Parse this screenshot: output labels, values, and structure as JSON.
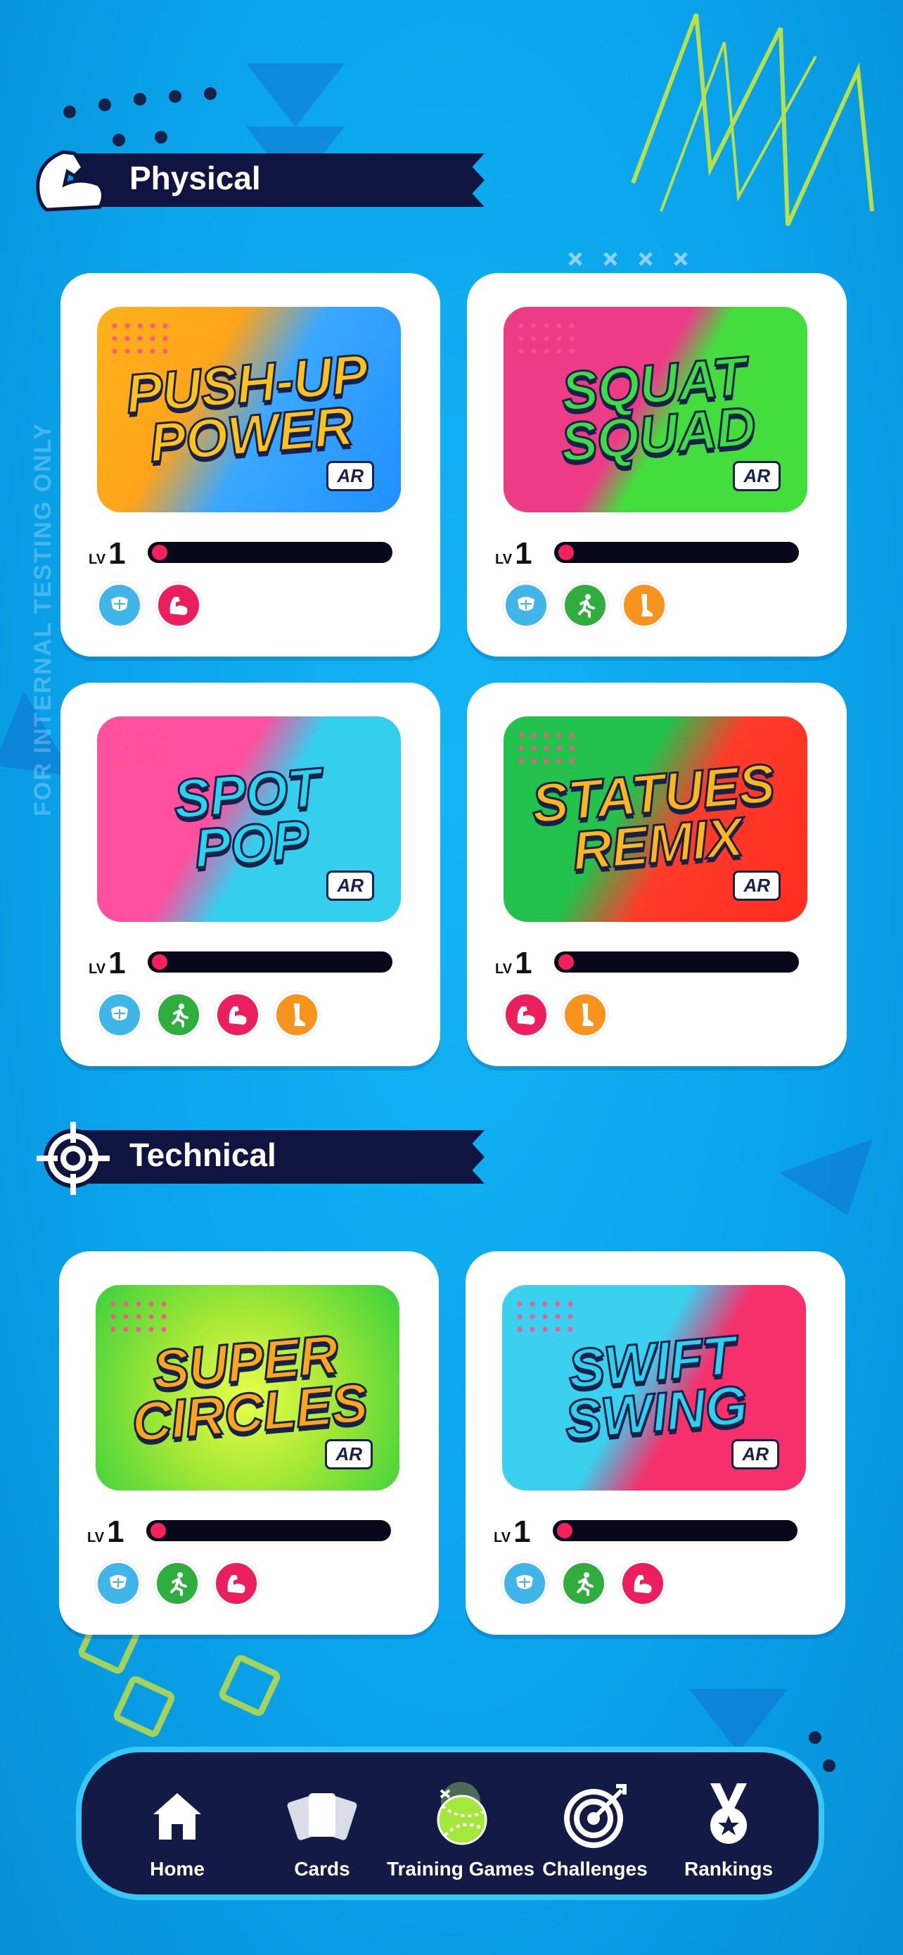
{
  "watermark": "FOR INTERNAL TESTING ONLY",
  "colors": {
    "background": "#0aa6ee",
    "banner": "#0f1440",
    "progress_fill": "#f4215c",
    "skill_blue": "#3fb5e8",
    "skill_green": "#2fae3e",
    "skill_pink": "#ec1f5e",
    "skill_orange": "#f7941d",
    "nav_bg": "#121a45",
    "nav_border": "#39c8f5"
  },
  "sections": [
    {
      "label": "Physical",
      "icon": "flexed-arm-icon",
      "games": [
        {
          "title": "PUSH-UP\nPOWER",
          "ar": "AR",
          "lv_text": "LV",
          "level": "1",
          "progress": 0.03,
          "skills": [
            "body-icon",
            "arm-icon"
          ]
        },
        {
          "title": "SQUAT\nSQUAD",
          "ar": "AR",
          "lv_text": "LV",
          "level": "1",
          "progress": 0.03,
          "skills": [
            "body-icon",
            "running-icon",
            "leg-icon"
          ]
        },
        {
          "title": "SPOT\nPOP",
          "ar": "AR",
          "lv_text": "LV",
          "level": "1",
          "progress": 0.03,
          "skills": [
            "body-icon",
            "running-icon",
            "arm-icon",
            "leg-icon"
          ]
        },
        {
          "title": "STATUES\nREMIX",
          "ar": "AR",
          "lv_text": "LV",
          "level": "1",
          "progress": 0.03,
          "skills": [
            "arm-icon",
            "leg-icon"
          ]
        }
      ]
    },
    {
      "label": "Technical",
      "icon": "crosshair-icon",
      "games": [
        {
          "title": "SUPER\nCIRCLES",
          "ar": "AR",
          "lv_text": "LV",
          "level": "1",
          "progress": 0.03,
          "skills": [
            "body-icon",
            "running-icon",
            "arm-icon"
          ]
        },
        {
          "title": "SWIFT\nSWING",
          "ar": "AR",
          "lv_text": "LV",
          "level": "1",
          "progress": 0.03,
          "skills": [
            "body-icon",
            "running-icon",
            "arm-icon"
          ]
        }
      ]
    }
  ],
  "nav": {
    "items": [
      {
        "label": "Home",
        "icon": "home-icon",
        "active": false
      },
      {
        "label": "Cards",
        "icon": "cards-icon",
        "active": false
      },
      {
        "label": "Training Games",
        "icon": "ball-icon",
        "active": true
      },
      {
        "label": "Challenges",
        "icon": "target-icon",
        "active": false
      },
      {
        "label": "Rankings",
        "icon": "medal-icon",
        "active": false
      }
    ]
  }
}
